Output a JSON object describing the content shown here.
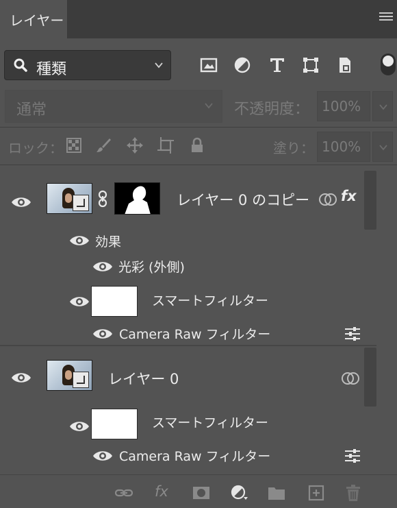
{
  "panel": {
    "tab_label": "レイヤー",
    "menu_icon": "hamburger-icon"
  },
  "filter": {
    "kind_label": "種類",
    "icons": [
      "image-filter-icon",
      "adjustment-filter-icon",
      "type-filter-icon",
      "shape-filter-icon",
      "smart-object-filter-icon"
    ],
    "toggle_state": "on"
  },
  "blend": {
    "mode_label": "通常",
    "opacity_label": "不透明度：",
    "opacity_value": "100%"
  },
  "lock": {
    "label": "ロック：",
    "icons": [
      "lock-transparent-pixels-icon",
      "lock-image-pixels-icon",
      "lock-position-icon",
      "lock-artboard-icon",
      "lock-all-icon"
    ],
    "fill_label": "塗り：",
    "fill_value": "100%"
  },
  "layers": [
    {
      "name": "レイヤー 0 のコピー",
      "has_mask": true,
      "effects_label": "効果",
      "effect_item": "光彩 (外側)",
      "smart_filters_label": "スマートフィルター",
      "filter_item": "Camera Raw フィルター",
      "fx_label": "fx"
    },
    {
      "name": "レイヤー 0",
      "smart_filters_label": "スマートフィルター",
      "filter_item": "Camera Raw フィルター"
    }
  ],
  "bottom_toolbar": {
    "icons": [
      "link-layers-icon",
      "fx-icon",
      "add-mask-icon",
      "new-adjustment-layer-icon",
      "new-group-icon",
      "new-layer-icon",
      "delete-layer-icon"
    ],
    "fx_label": "fx"
  }
}
